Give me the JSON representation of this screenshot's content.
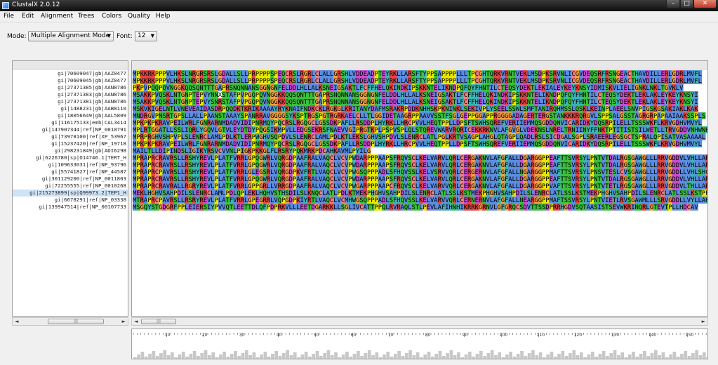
{
  "window": {
    "title": "ClustalX 2.0.12",
    "minimize": "–",
    "maximize": "□",
    "close": "✕"
  },
  "menu": [
    "File",
    "Edit",
    "Alignment",
    "Trees",
    "Colors",
    "Quality",
    "Help"
  ],
  "toolbar": {
    "mode_label": "Mode:",
    "mode_value": "Multiple Alignment Mode",
    "font_label": "Font:",
    "font_value": "12"
  },
  "icons": {
    "app": "clustalx-app-icon",
    "dropdown": "chevron-down-icon",
    "scroll_left": "scroll-left-icon",
    "scroll_right": "scroll-right-icon",
    "scroll_grip": "scroll-grip-icon"
  },
  "colors": {
    "hydrophobic": "#5b8de0",
    "positive": "#e04444",
    "negative": "#c64cd0",
    "polar": "#3bbf3b",
    "cysteine": "#f08080",
    "glycine": "#f0a040",
    "proline": "#e8e800",
    "aromatic": "#3bb4b4",
    "selected_row": "#cfe3f7"
  },
  "sequences": [
    {
      "name": "gi|70609047|gb|AAZ0477",
      "seq": "MPKKRKPPPVLHKSLNRGRSRSLGDALLSLLPRPPPPSPEQCRSLRGRLCLALLGRSHLVDDEADPTEYRKLLARSFTYPPSAPPPPLLLTPCGHTQRKVRNTVEKLMSDPKSRVNLICGVDEQSRFRSNGEACTHAVDILLERLGDRLMVFL"
    },
    {
      "name": "gi|70609045|gb|AAZ0477",
      "seq": "MPKKRKPPPVLHKSLNRGRSRSLGDALLSLLPRPPPPSPEQCRSLRGRLCLALLGRSHLVDDEADPTEYRKLLARSFTYPPSAPPPPLLLTPCGHTQRKVRNTVEKLMSDPKSRVNLICGVDEQSRFRSNGEACTHAVDILLERLGDRLMVFL"
    },
    {
      "name": "gi|27371385|gb|AAN8786",
      "seq": "PKPVPQQPQVNGGKQQSQNTTTGAPRSNQNNANSGGNGNFELDDLHLLALKSNEIGSAKTLFCFFHELQKINDKIPSKKNTELIKNDPQFQYFHNTILCTEQSYDEKTLEKIALEYKEYKNSYIDMISKVLIELIGNKLNKLTGVKLV"
    },
    {
      "name": "gi|27371383|gb|AAN8786",
      "seq": "MSAKKPVQSKLNTGNPTEPVYNNXSTAFPVPGQPQVNGGKKQQSQNTTTGAPRSNQNNANSGGNGNFELDDLHLLALKSNEIGSAKTLFCFFHELQKINDKIPSKKNTELIKNDPQFQYFHNTILCTEQSYDEKTLEKLAKLEYKEYKNSYI"
    },
    {
      "name": "gi|27371381|gb|AAN8786",
      "seq": "MSAKKPVQSKLNTGNPTEPVYSNRSTAFPVPGQPQVNGGKKQQSQNTTTGAPRSNQNNANSGGNGNFELDDLHLLALKSNEIGSAKTLFCFFHELQKINDKIPSKKNTELIKNDPQFQYFHNTILCTEQSYDEKTLEKLAKLEYKEYKNSYI"
    },
    {
      "name": "gi|1488231|gb|AAB8110",
      "seq": "MSKVKIGELNTLVNEVEAIDASDRPQQDKTKRIKAAAAYRYKNAIFNDKCKLRGKGLKRITANYDAFMSRAKRPDDKNHHSKPKNINKLSEKIVPLYSEELSSWLSMFTANIRQHMSSLQSKLKEINPLAEELSNVPIGSKGSAKIAKLKAK"
    },
    {
      "name": "gi|18056649|gb|AAL5809",
      "seq": "MNDRGVPNSRTGPSLLALLPAANSTAAAYSPANRRAVGGGGSYKSPTRGSPGTRGRKAELCLLTLGGIDETAAGRPPAAVVSSTFSGLGEPPGGAPPRGGGGADAGERTERGSTANKKKRQRGVLSPPSALGSSTAGRGRPAPAAIAAKSSPLS"
    },
    {
      "name": "gi|116175133|emb|CAL3414",
      "seq": "MPKPKPKRAVPEILWRLFGNRARNMDADVIDIPNRMQYPQCRSLRGQGCLGSSDKPAFLLRSDDPLHYRKLLHRCPVVLHEQTPPLLDPSFTSWHSQREFVERIIEMMQSGDDQNVICARIDKYDQSRPILELLTSSSWKFLKRVGDHVMVYL"
    },
    {
      "name": "gi|147907344|ref|NP_0010791",
      "seq": "MPLRTGGATLLSSLIQRLYGQVLGTVLEYDTDYPQGSIKMPVLLEDGSEKRSFNAEVVGIPRGTKPLPSPVSPLQLSTQREVWARVRQRICEKKRKNVLAFGVGLVDEKNSLNRELTRNIINYFFNKTPTITISTSILWETLLTRVGDDVNHWNHHE"
    },
    {
      "name": "gi|73978100|ref|XP_53967",
      "seq": "MPRPRGHVSHPVPLSLENRCLAMLPDLKTLERPWGHVSQPDVLSLENRCLAMLPDLKTLEKSLGHVSHPDVLSLENRCLATLPGLKRTVSAGPLAHGLQTAGPLQADLRSLSICDGALSGPLSRAEERLEGSGCTSPRALQPISATVASAAAAL"
    },
    {
      "name": "gi|15237420|ref|NP_19718",
      "seq": "MPKPKPKRAVPEILWRLFGNRARNMDADVIDIPNRMQYPQCRSLRGQGCLGSSDKPAFLLRSDDPLHYRKLLHRCPVVLHEQTPPLLDPSFTSWHSQREFVERIIEMMQSGDDQNVICARIDKYDQSRPILELLTSSSWKFLKRVGDHVMVYL"
    },
    {
      "name": "gi|298231849|gb|ADI6298",
      "seq": "MAILTLLDIPINDSLIGIKYRSVCVVNLPIGKPKKGLFLRSRYPQKMRKPDCAHKAVMLPYILG"
    },
    {
      "name": "gi|6226780|sp|O14746.1|TERT_H",
      "seq": "MPRAPRCRAVRSLLRSHYREVLPLATFVRRLGPQGWRLVQRGDPAAFRALVAQCLVCVPWDARPPPAAPSFRQVSCLKELVARVLQRLCERGAKNVLAFGFALLDGARGGPPEAFTTSVRSYLPNTVTDALRGSGAWGLLLRRVGDDVLVHLLARC"
    },
    {
      "name": "gi|109633031|ref|NP_93796",
      "seq": "MPRAPRCRAVRSLLRSHYREVLPLATFVRRLGPQGWRLVQRGDPAAFRALVAQCLVCVPWDARPPPAAPSFRQVSCLKELVARVLQRLCERGAKNVLAFGFALLDGARGGPPEAFTTSVRSYLPNTVTDALRGSGAWGLLLRRVGDDVLVHLLARC"
    },
    {
      "name": "gi|55741827|ref|NP_44587",
      "seq": "MPRAPRCPAVRSLLRSHYREVLPLATFVRRLGLEGSRLVQRGDPKVFRTLVAQCLVCVPWGSQPPPADLSFHQVSSLKELVSRVVQRLCERGERNVLAFGFALLNGARGGPPMAFTTSVRSYLPNSVTESLCVSGAWGLLLRRVGDDLLVHLSHC"
    },
    {
      "name": "gi|301129200|ref|NP_0011803",
      "seq": "MPRAPRCRAVRSLLRSHYREVLPLATFVRRLGPQGWRLVQRGDPAAFRALVAQCLVCVPWDARPPPAAPSFRQVSCLKELVARVLQRLCERGAKNVLAFGFALLDGARGGPPEAFTTSVRSYLPNTVTDALRGSGAWGLLLRRVGDDVLVHLLARC"
    },
    {
      "name": "gi|72255555|ref|NP_0010268",
      "seq": "MPRAPRCRAVRALLRGRYREVLPLATFVRRLGPPGRLLVRRGDPAAFRALVAQCLVCVPWGARPPPAAPCFRQVSCLKELVARVVQRLCERGAKNVLAFGFALLDGARGGPPVAFTTSVRSYLPNTVTETLRGSGAWGLLLRRVGDDVLTHLLARC"
    },
    {
      "name": "gi|215273899|sp|Q99973.2|TEP1_H",
      "seq": "MEKLHGHVSAHPDILSLENRCLAMLPDLQPLEKLHQHVSTHSDILSLKNQCLATLPDLKTMEKPHGHVSAHPDILSLENRCLATLSSLKSTMEKPHGHVSAHPDILSLENRCLATLSSLKSTMEKPHGHVSAHPDILSLENRCLATLSSLKSTPPPPP"
    },
    {
      "name": "gi|6678291|ref|NP_03338",
      "seq": "MTRAPRCPAVRSLLRSRYREVLPLATFVRRLGPEGRRLVQPGDPKIYRTLVAQCLVCMHWGSQPPPADLSFHQVSSLKELVARVVQRLCERNERNVLAFGFALLNEARGGPPMAFTSSVRSYLPNTVIETLRVSGAWMLLLSRVGDDLLVYLLAHC"
    },
    {
      "name": "gi|139947514|ref|NP_00107733",
      "seq": "MSGQYSTGDGRFPPLEIERSIYPVVQTLEETTDLQFPDPRKVLLLEETDGARKKLLSGLIVCATTPPQLRVRAQLSTLPEVLAFIHNHIKRRKGRNVLGFGRQCSDVTTSSDPRRHGDVSQTAASISTSEVWKRINQRLGTEVTPLLHDCAV"
    }
  ],
  "ruler": {
    "labels": [
      "10",
      "20",
      "30",
      "40",
      "50",
      "60",
      "70",
      "80",
      "90",
      "100",
      "110",
      "120",
      "130",
      "140",
      "150"
    ]
  }
}
